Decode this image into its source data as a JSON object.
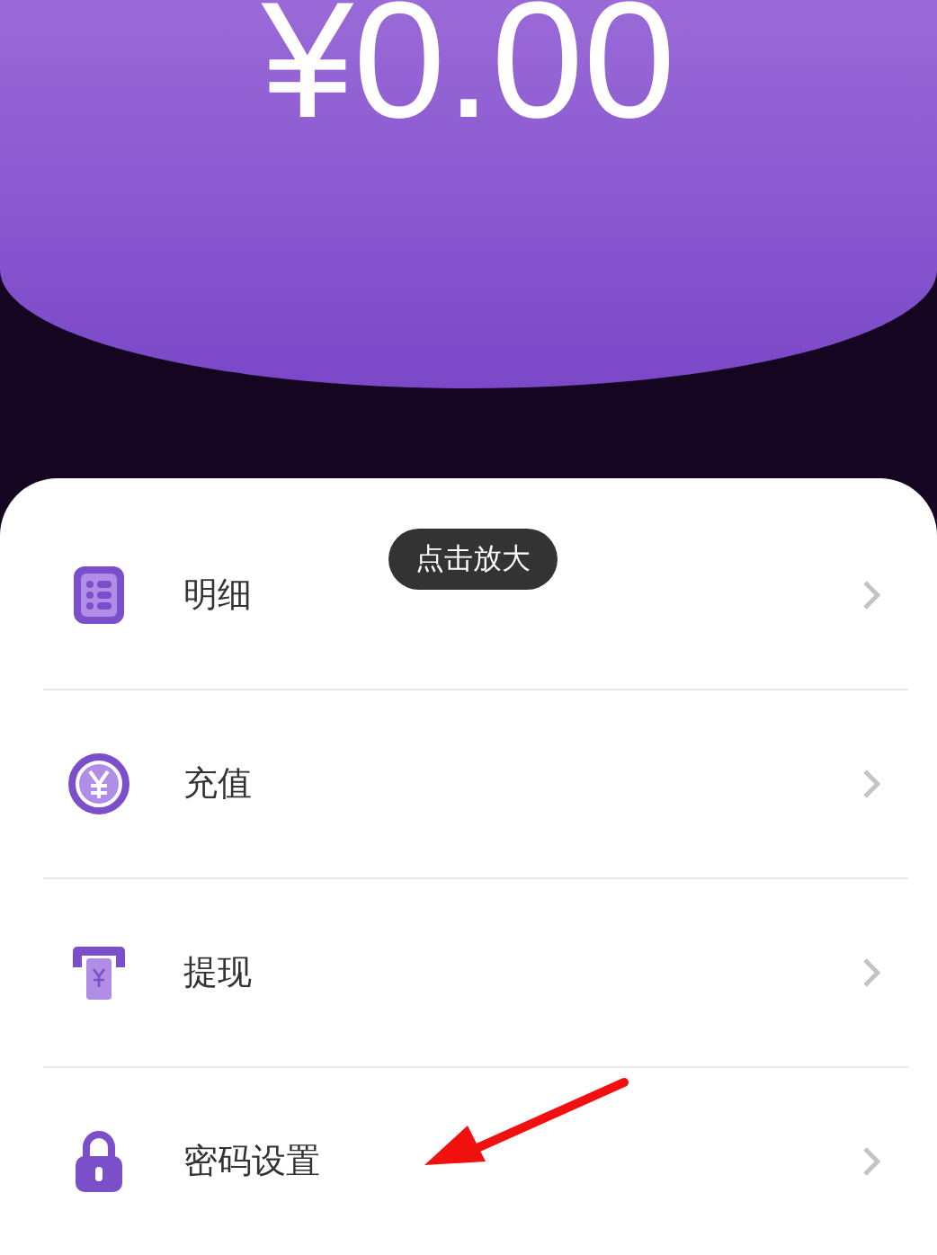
{
  "balance": {
    "amount": "¥0.00"
  },
  "menu": [
    {
      "label": "明细",
      "kind": "detail"
    },
    {
      "label": "充值",
      "kind": "recharge"
    },
    {
      "label": "提现",
      "kind": "withdraw"
    },
    {
      "label": "密码设置",
      "kind": "password"
    }
  ],
  "tooltip": {
    "text": "点击放大"
  }
}
